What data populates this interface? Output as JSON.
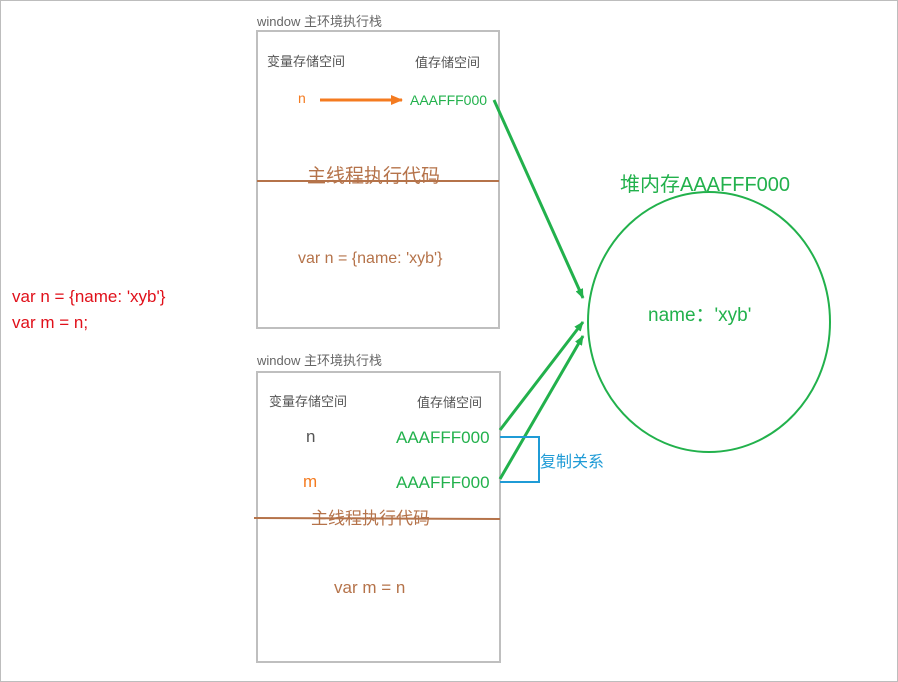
{
  "code": {
    "line1": "var n = {name: 'xyb'}",
    "line2": "var m = n;"
  },
  "stack1": {
    "title": "window 主环境执行栈",
    "var_header": "变量存储空间",
    "val_header": "值存储空间",
    "var_name": "n",
    "value": "AAAFFF000",
    "section_label": "主线程执行代码",
    "code": "var n = {name: 'xyb'}"
  },
  "stack2": {
    "title": "window 主环境执行栈",
    "var_header": "变量存储空间",
    "val_header": "值存储空间",
    "var_n": "n",
    "value_n": "AAAFFF000",
    "var_m": "m",
    "value_m": "AAAFFF000",
    "copy_label": "复制关系",
    "section_label": "主线程执行代码",
    "code": "var m = n"
  },
  "heap": {
    "title": "堆内存AAAFFF000",
    "content": "name：'xyb'"
  },
  "colors": {
    "green": "#22b14c",
    "orange": "#f47b20",
    "brown": "#b5734a",
    "red": "#e0101a",
    "blue": "#1f9bd6",
    "gray_text": "#555555",
    "box_border": "#bfbfbf"
  }
}
